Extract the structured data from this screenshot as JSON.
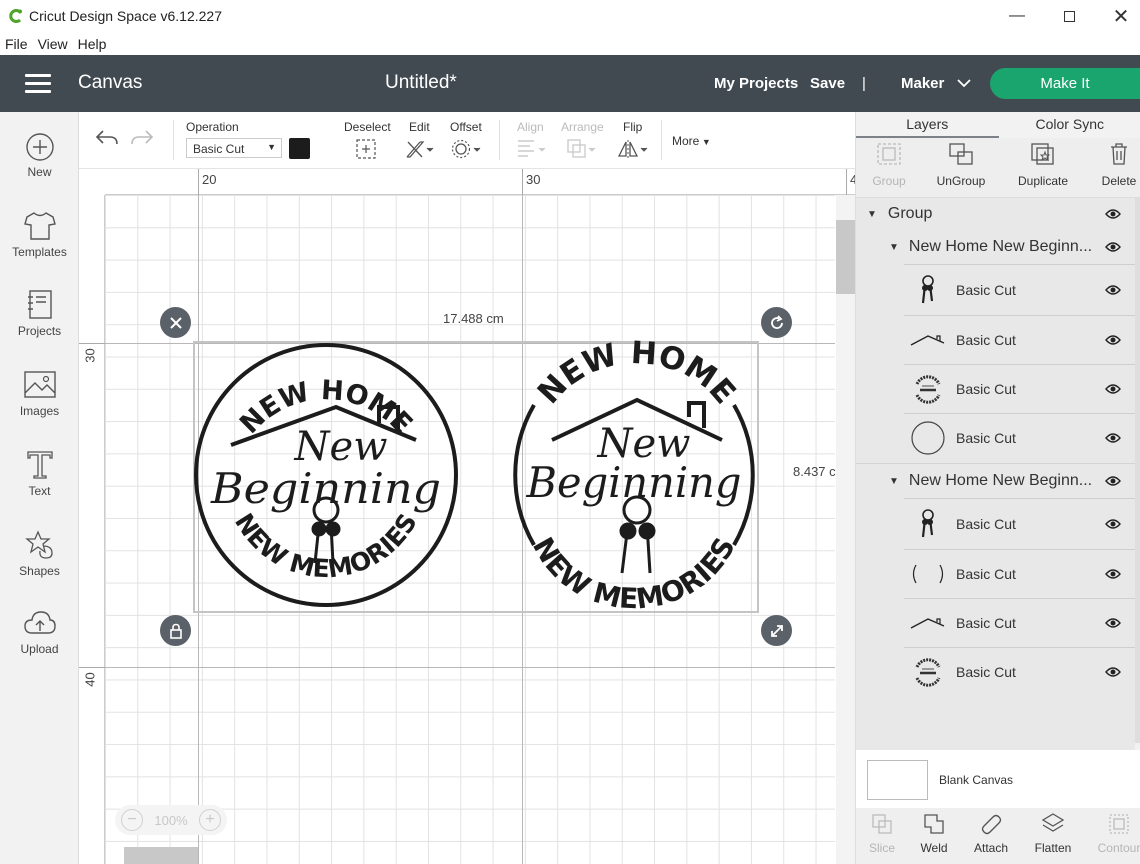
{
  "window": {
    "title": "Cricut Design Space  v6.12.227",
    "controls": [
      "minimize-icon",
      "maximize-icon",
      "close-icon"
    ]
  },
  "menu": [
    "File",
    "View",
    "Help"
  ],
  "header": {
    "section": "Canvas",
    "document_title": "Untitled*",
    "my_projects": "My Projects",
    "save": "Save",
    "separator": "|",
    "machine": "Maker",
    "make_it": "Make It",
    "colors": {
      "bar": "#414a51",
      "make_it": "#1aa56e"
    }
  },
  "sidebar": {
    "items": [
      {
        "label": "New",
        "icon": "plus-circle-icon"
      },
      {
        "label": "Templates",
        "icon": "tshirt-icon"
      },
      {
        "label": "Projects",
        "icon": "notebook-icon"
      },
      {
        "label": "Images",
        "icon": "image-icon"
      },
      {
        "label": "Text",
        "icon": "text-t-icon"
      },
      {
        "label": "Shapes",
        "icon": "shapes-icon"
      },
      {
        "label": "Upload",
        "icon": "cloud-upload-icon"
      }
    ]
  },
  "toolbar": {
    "operation_label": "Operation",
    "operation_value": "Basic Cut",
    "deselect": "Deselect",
    "edit": "Edit",
    "offset": "Offset",
    "align": "Align",
    "arrange": "Arrange",
    "flip": "Flip",
    "more": "More"
  },
  "canvas": {
    "ruler_top": [
      "20",
      "30"
    ],
    "ruler_top_edge": "4",
    "ruler_left": [
      "30",
      "40"
    ],
    "width_label": "17.488 cm",
    "height_label": "8.437 c",
    "zoom": "100%",
    "designs": [
      {
        "top": "NEW HOME",
        "middle_1": "New",
        "middle_2": "Beginning",
        "bottom": "NEW MEMORIES"
      },
      {
        "top": "NEW HOME",
        "middle_1": "New",
        "middle_2": "Beginning",
        "bottom": "NEW MEMORIES"
      }
    ]
  },
  "panel": {
    "tabs": [
      "Layers",
      "Color Sync"
    ],
    "actions": [
      {
        "label": "Group",
        "enabled": false
      },
      {
        "label": "UnGroup",
        "enabled": true
      },
      {
        "label": "Duplicate",
        "enabled": true
      },
      {
        "label": "Delete",
        "enabled": true
      }
    ],
    "group_label": "Group",
    "subgroups": [
      {
        "name": "New Home New Beginn...",
        "layers": [
          {
            "thumb": "keys-thumb",
            "label": "Basic Cut"
          },
          {
            "thumb": "roof-thumb",
            "label": "Basic Cut"
          },
          {
            "thumb": "text-badge-thumb",
            "label": "Basic Cut"
          },
          {
            "thumb": "circle-thumb",
            "label": "Basic Cut"
          }
        ]
      },
      {
        "name": "New Home New Beginn...",
        "layers": [
          {
            "thumb": "keys-thumb",
            "label": "Basic Cut"
          },
          {
            "thumb": "parentheses-thumb",
            "label": "Basic Cut"
          },
          {
            "thumb": "roof-thumb",
            "label": "Basic Cut"
          },
          {
            "thumb": "text-badge-thumb",
            "label": "Basic Cut"
          }
        ]
      }
    ],
    "blank_canvas": "Blank Canvas",
    "bottom_actions": [
      {
        "label": "Slice",
        "enabled": false
      },
      {
        "label": "Weld",
        "enabled": true
      },
      {
        "label": "Attach",
        "enabled": true
      },
      {
        "label": "Flatten",
        "enabled": true
      },
      {
        "label": "Contour",
        "enabled": false
      }
    ]
  }
}
